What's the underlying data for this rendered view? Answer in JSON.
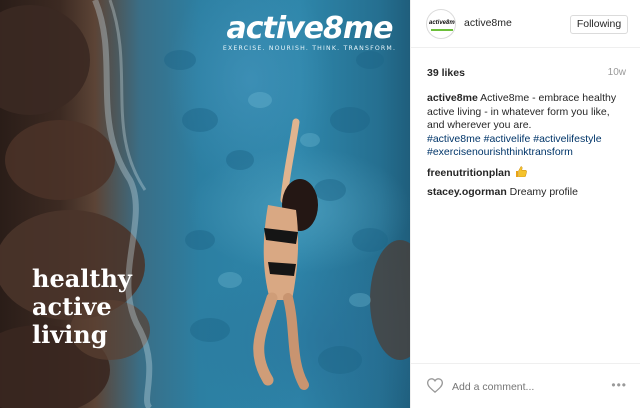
{
  "photo": {
    "logo_text": "active8me",
    "tagline": "EXERCISE. NOURISH. THINK. TRANSFORM.",
    "overlay_lines": [
      "healthy",
      "active",
      "living"
    ]
  },
  "header": {
    "avatar_text": "active8me",
    "username": "active8me",
    "follow_label": "Following"
  },
  "post": {
    "likes": "39 likes",
    "time": "10w",
    "caption_user": "active8me",
    "caption_text": "Active8me - embrace healthy active living - in whatever form you like, and wherever you are.",
    "hashtags": [
      "#active8me",
      "#activelife",
      "#activelifestyle",
      "#exercisenourishthinktransform"
    ],
    "comments": [
      {
        "user": "freenutritionplan",
        "text": "",
        "emoji": "thumbs-up-icon"
      },
      {
        "user": "stacey.ogorman",
        "text": "Dreamy profile"
      }
    ]
  },
  "footer": {
    "comment_placeholder": "Add a comment...",
    "more_label": "•••"
  },
  "colors": {
    "hashtag": "#003569",
    "accent_green": "#6cbf3a",
    "border": "#efefef"
  }
}
